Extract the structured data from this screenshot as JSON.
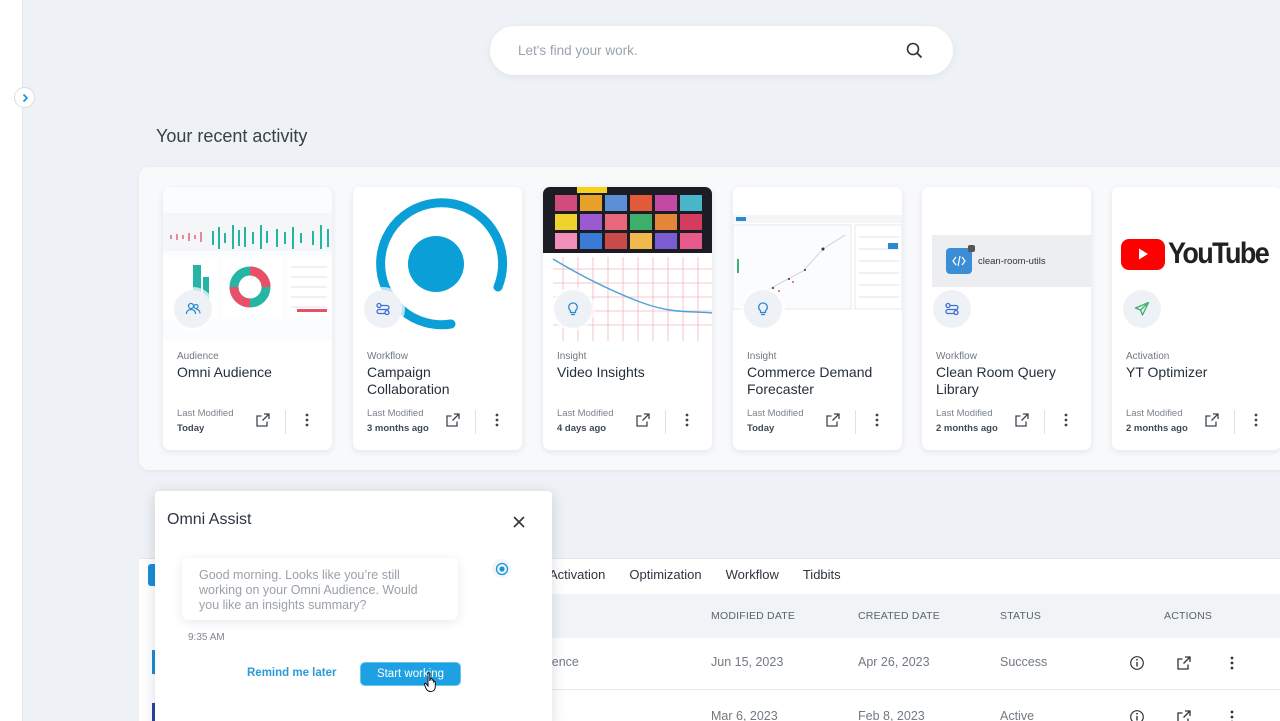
{
  "search": {
    "placeholder": "Let's find your work."
  },
  "recent": {
    "title": "Your recent activity",
    "last_modified_label": "Last Modified",
    "cards": [
      {
        "category": "Audience",
        "name": "Omni Audience",
        "modified": "Today",
        "badge_icon": "people-icon"
      },
      {
        "category": "Workflow",
        "name": "Campaign Collaboration",
        "modified": "3 months ago",
        "badge_icon": "workflow-icon"
      },
      {
        "category": "Insight",
        "name": "Video Insights",
        "modified": "4 days ago",
        "badge_icon": "lightbulb-icon"
      },
      {
        "category": "Insight",
        "name": "Commerce Demand Forecaster",
        "modified": "Today",
        "badge_icon": "lightbulb-icon"
      },
      {
        "category": "Workflow",
        "name": "Clean Room Query Library",
        "modified": "2 months ago",
        "badge_icon": "workflow-icon",
        "thumb_label": "clean-room-utils"
      },
      {
        "category": "Activation",
        "name": "YT Optimizer",
        "modified": "2 months ago",
        "badge_icon": "paper-plane-icon",
        "thumb_label": "YouTube"
      }
    ]
  },
  "table": {
    "tabs": [
      "Activation",
      "Optimization",
      "Workflow",
      "Tidbits"
    ],
    "columns": {
      "modified": "MODIFIED DATE",
      "created": "CREATED DATE",
      "status": "STATUS",
      "actions": "ACTIONS"
    },
    "rows": [
      {
        "name": "ience",
        "modified": "Jun 15, 2023",
        "created": "Apr 26, 2023",
        "status": "Success"
      },
      {
        "name": "",
        "modified": "Mar 6, 2023",
        "created": "Feb 8, 2023",
        "status": "Active"
      }
    ]
  },
  "assist": {
    "title": "Omni Assist",
    "message": "Good morning. Looks like you’re still working on your Omni Audience. Would you like an insights summary?",
    "time": "9:35 AM",
    "remind_label": "Remind me later",
    "start_label": "Start working"
  },
  "colors": {
    "accent": "#1ea1e2",
    "youtube_red": "#ff0000",
    "teal": "#20b8a6",
    "pink": "#e8506a"
  }
}
